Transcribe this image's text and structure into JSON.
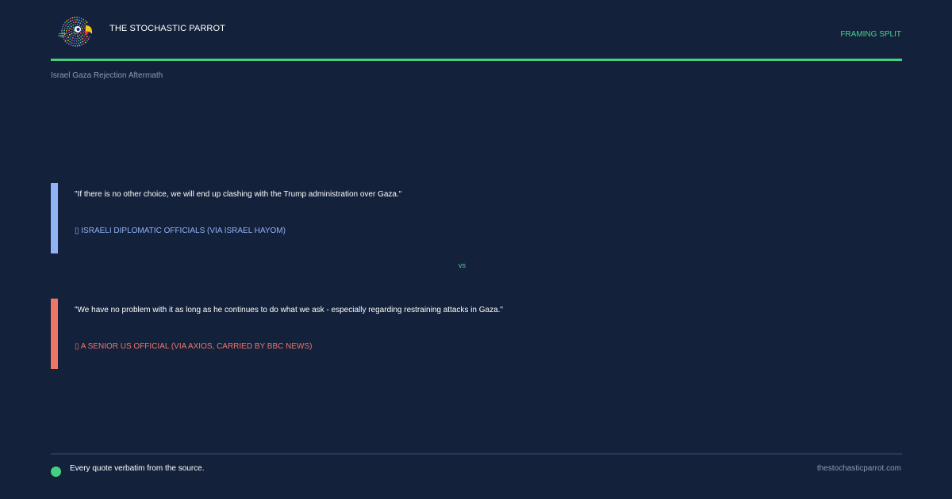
{
  "header": {
    "brand_name": "THE STOCHASTIC PARROT",
    "tag": "FRAMING SPLIT",
    "topic": "Israel Gaza Rejection Aftermath",
    "logo_icon": "parrot-logo-icon"
  },
  "quotes": [
    {
      "text": "\"If there is no other choice, we will end up clashing with the Trump administration over Gaza.\"",
      "attribution": "▯ ISRAELI DIPLOMATIC OFFICIALS (VIA ISRAEL HAYOM)",
      "accent": "#8fb3f4"
    },
    {
      "text": "\"We have no problem with it as long as he continues to do what we ask - especially regarding restraining attacks in Gaza.\"",
      "attribution": "▯ A SENIOR US OFFICIAL (VIA AXIOS, CARRIED BY BBC NEWS)",
      "accent": "#f07566"
    }
  ],
  "separator": "vs",
  "footer": {
    "note": "Every quote verbatim from the source.",
    "url": "thestochasticparrot.com"
  },
  "colors": {
    "background": "#13213b",
    "accent_green": "#43d17f",
    "quote_a_accent": "#8fb3f4",
    "quote_b_accent": "#f07566"
  }
}
